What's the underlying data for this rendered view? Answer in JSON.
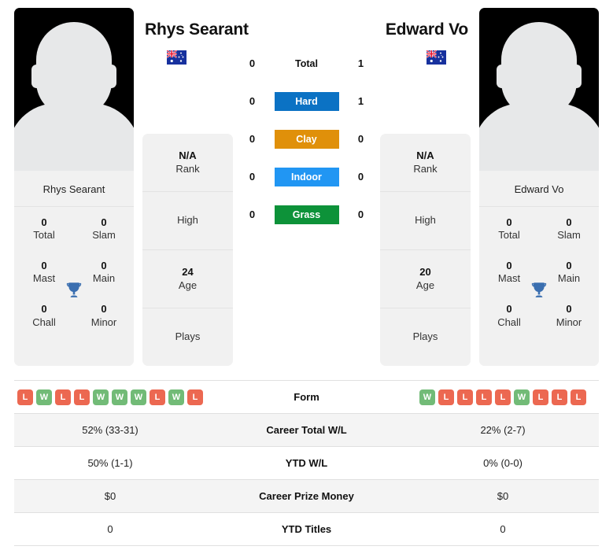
{
  "players": {
    "left": {
      "name": "Rhys Searant",
      "card_name": "Rhys Searant",
      "flag": "australia-flag",
      "rank": "N/A",
      "rank_label": "Rank",
      "high_label": "High",
      "high_value": "",
      "age": "24",
      "age_label": "Age",
      "plays_label": "Plays",
      "plays_value": "",
      "titles": [
        {
          "num": "0",
          "label": "Total"
        },
        {
          "num": "0",
          "label": "Slam"
        },
        {
          "num": "0",
          "label": "Mast"
        },
        {
          "num": "0",
          "label": "Main"
        },
        {
          "num": "0",
          "label": "Chall"
        },
        {
          "num": "0",
          "label": "Minor"
        }
      ],
      "form": [
        "L",
        "W",
        "L",
        "L",
        "W",
        "W",
        "W",
        "L",
        "W",
        "L"
      ],
      "career_wl": "52% (33-31)",
      "ytd_wl": "50% (1-1)",
      "career_prize": "$0",
      "ytd_titles": "0"
    },
    "right": {
      "name": "Edward Vo",
      "card_name": "Edward Vo",
      "flag": "australia-flag",
      "rank": "N/A",
      "rank_label": "Rank",
      "high_label": "High",
      "high_value": "",
      "age": "20",
      "age_label": "Age",
      "plays_label": "Plays",
      "plays_value": "",
      "titles": [
        {
          "num": "0",
          "label": "Total"
        },
        {
          "num": "0",
          "label": "Slam"
        },
        {
          "num": "0",
          "label": "Mast"
        },
        {
          "num": "0",
          "label": "Main"
        },
        {
          "num": "0",
          "label": "Chall"
        },
        {
          "num": "0",
          "label": "Minor"
        }
      ],
      "form": [
        "W",
        "L",
        "L",
        "L",
        "L",
        "W",
        "L",
        "L",
        "L"
      ],
      "career_wl": "22% (2-7)",
      "ytd_wl": "0% (0-0)",
      "career_prize": "$0",
      "ytd_titles": "0"
    }
  },
  "surfaces": [
    {
      "label": "Total",
      "left": "0",
      "right": "1",
      "color": "transparent",
      "text_color": "#111111"
    },
    {
      "label": "Hard",
      "left": "0",
      "right": "1",
      "color": "#0b72c4",
      "text_color": "#ffffff"
    },
    {
      "label": "Clay",
      "left": "0",
      "right": "0",
      "color": "#e0900a",
      "text_color": "#ffffff"
    },
    {
      "label": "Indoor",
      "left": "0",
      "right": "0",
      "color": "#2196f3",
      "text_color": "#ffffff"
    },
    {
      "label": "Grass",
      "left": "0",
      "right": "0",
      "color": "#0d9239",
      "text_color": "#ffffff"
    }
  ],
  "table": {
    "rows": [
      {
        "label": "Form",
        "type": "form"
      },
      {
        "label": "Career Total W/L",
        "left": "52% (33-31)",
        "right": "22% (2-7)"
      },
      {
        "label": "YTD W/L",
        "left": "50% (1-1)",
        "right": "0% (0-0)"
      },
      {
        "label": "Career Prize Money",
        "left": "$0",
        "right": "$0"
      },
      {
        "label": "YTD Titles",
        "left": "0",
        "right": "0"
      }
    ]
  },
  "colors": {
    "win_badge": "#72bb77",
    "loss_badge": "#ec6851",
    "card_bg": "#f1f1f1",
    "row_alt_bg": "#f4f4f4",
    "trophy": "#3b6fb0"
  }
}
